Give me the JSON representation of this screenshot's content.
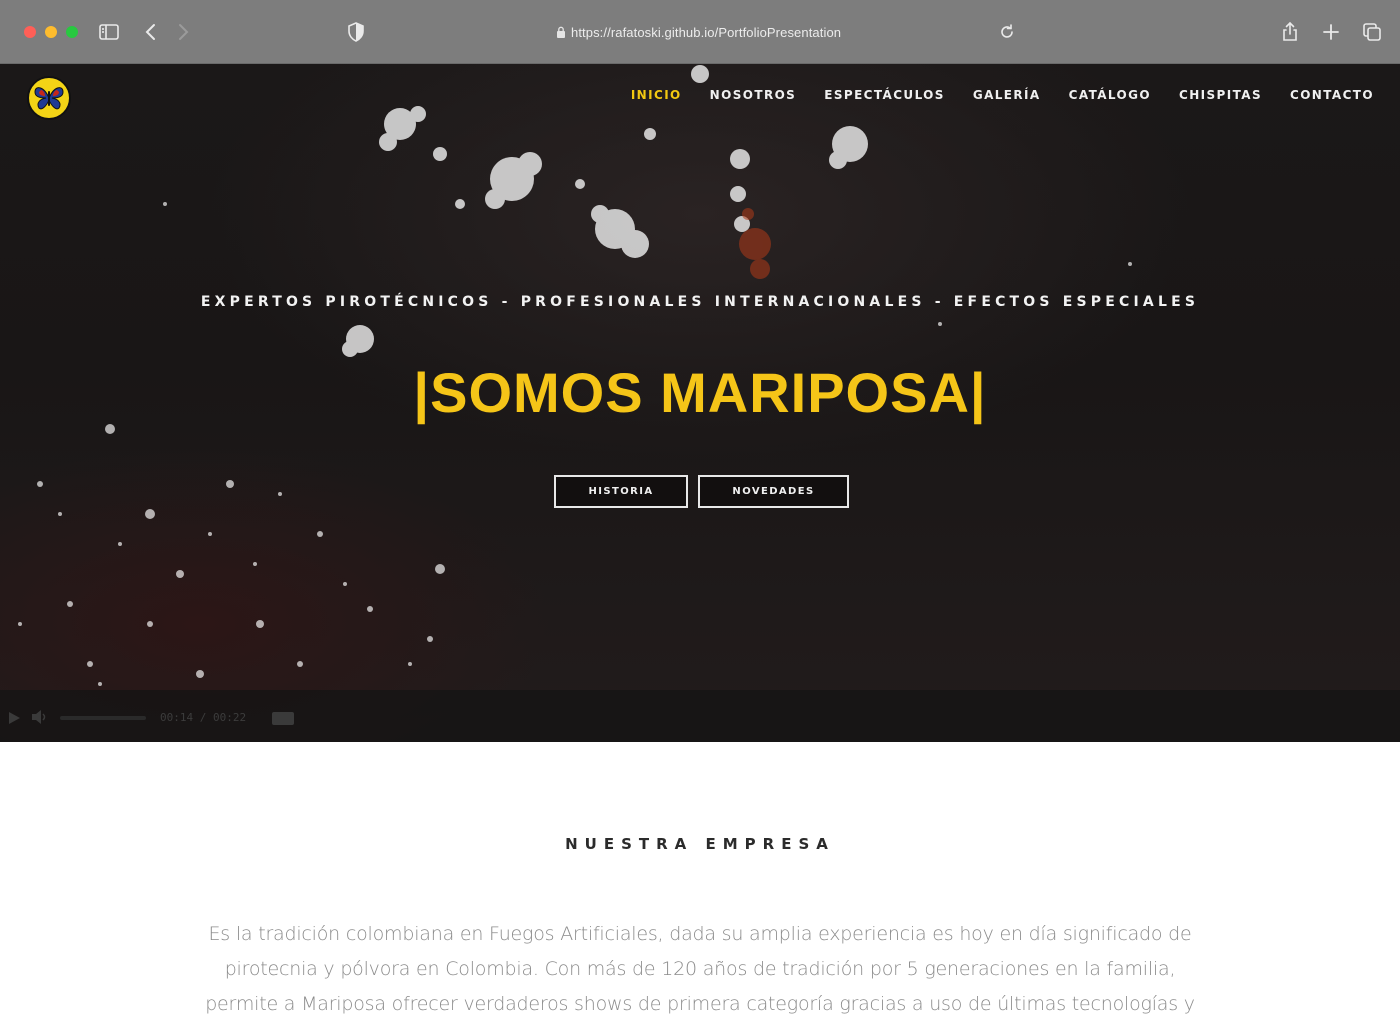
{
  "browser": {
    "url": "https://rafatoski.github.io/PortfolioPresentation",
    "icons": [
      "sidebar-icon",
      "back-icon",
      "forward-icon",
      "shield-icon",
      "lock-icon",
      "reload-icon",
      "share-icon",
      "new-tab-icon",
      "tabs-icon"
    ]
  },
  "nav": {
    "items": [
      {
        "label": "INICIO",
        "active": true
      },
      {
        "label": "NOSOTROS",
        "active": false
      },
      {
        "label": "ESPECTÁCULOS",
        "active": false
      },
      {
        "label": "GALERÍA",
        "active": false
      },
      {
        "label": "CATÁLOGO",
        "active": false
      },
      {
        "label": "CHISPITAS",
        "active": false
      },
      {
        "label": "CONTACTO",
        "active": false
      }
    ]
  },
  "hero": {
    "tagline": "EXPERTOS PIROTÉCNICOS - PROFESIONALES INTERNACIONALES - EFECTOS ESPECIALES",
    "headline": "|SOMOS MARIPOSA|",
    "buttons": {
      "historia": "HISTORIA",
      "novedades": "NOVEDADES"
    },
    "video": {
      "time": "00:14 / 00:22"
    }
  },
  "company": {
    "title": "NUESTRA EMPRESA",
    "body": "Es la tradición colombiana en Fuegos Artificiales, dada su amplia experiencia es hoy en día significado de pirotecnia y pólvora en Colombia. Con más de 120 años de tradición por 5 generaciones en la familia, permite a Mariposa ofrecer verdaderos shows de primera categoría gracias a uso de últimas tecnologías y"
  },
  "colors": {
    "accent": "#f5c518",
    "hero_bg": "#1b1818",
    "chrome": "#7d7d7d",
    "body_text": "#8b8b8b"
  }
}
